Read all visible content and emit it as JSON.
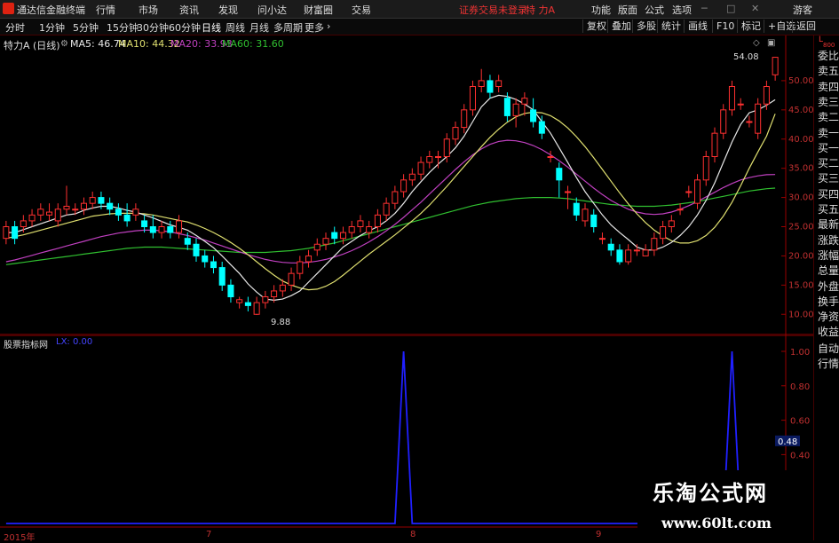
{
  "menubar": {
    "app_title": "通达信金融终端",
    "items": [
      "行情",
      "市场",
      "资讯",
      "发现",
      "问小达",
      "财富圈",
      "交易"
    ],
    "login_status": "证券交易未登录",
    "stock_name": "特 力A",
    "right_items": [
      "功能",
      "版面",
      "公式",
      "选项"
    ],
    "guest": "游客"
  },
  "periodbar": {
    "periods": [
      "分时",
      "1分钟",
      "5分钟",
      "15分钟",
      "30分钟",
      "60分钟",
      "日线",
      "周线",
      "月线",
      "多周期",
      "更多"
    ],
    "active_period": "日线",
    "tools": [
      "复权",
      "叠加",
      "多股",
      "统计",
      "画线",
      "F10",
      "标记",
      "+自选",
      "返回"
    ]
  },
  "main_chart": {
    "stock_label": "特力A",
    "period_label": "(日线)",
    "ma5": "MA5: 46.74",
    "ma10": "MA10: 44.32",
    "ma20": "MA20: 33.93",
    "ma60": "MA60: 31.60",
    "high_label": "54.08",
    "low_label": "9.88",
    "yaxis": [
      "50.00",
      "45.00",
      "40.00",
      "35.00",
      "30.00",
      "25.00",
      "20.00",
      "15.00",
      "10.00"
    ],
    "colors": {
      "up": "#ff3030",
      "down": "#00ffff",
      "ma5": "#e8e8e8",
      "ma10": "#e0e070",
      "ma20": "#c040c0",
      "ma60": "#30c030"
    }
  },
  "sub_chart": {
    "title": "股票指标网",
    "value_label": "LX: 0.00",
    "yaxis": [
      "1.00",
      "0.80",
      "0.60",
      "0.48",
      "0.40"
    ],
    "current_value": "0.48",
    "color": "#2020ff"
  },
  "xaxis": [
    "2015年",
    "7",
    "8",
    "9"
  ],
  "right_panel": {
    "corner_top": "L",
    "corner_bottom": "800",
    "items": [
      "委比",
      "卖五",
      "卖四",
      "卖三",
      "卖二",
      "卖一",
      "买一",
      "买二",
      "买三",
      "买四",
      "买五",
      "最新",
      "涨跌",
      "涨幅",
      "总量",
      "外盘",
      "换手",
      "净资",
      "收益"
    ],
    "bottom_items": [
      "自动",
      "行情"
    ]
  },
  "watermark": {
    "line1": "乐淘公式网",
    "line2": "www.60lt.com"
  },
  "chart_data": {
    "type": "candlestick",
    "title": "特力A (日线)",
    "ylim": [
      7,
      55
    ],
    "candles": [
      {
        "o": 23,
        "c": 25,
        "h": 26,
        "l": 22
      },
      {
        "o": 25,
        "c": 23,
        "h": 26,
        "l": 22
      },
      {
        "o": 25,
        "c": 26,
        "h": 27,
        "l": 24
      },
      {
        "o": 26,
        "c": 27,
        "h": 28,
        "l": 25
      },
      {
        "o": 27,
        "c": 28,
        "h": 29,
        "l": 26
      },
      {
        "o": 27,
        "c": 27.5,
        "h": 29,
        "l": 26
      },
      {
        "o": 26,
        "c": 28,
        "h": 29,
        "l": 25
      },
      {
        "o": 28,
        "c": 28.5,
        "h": 32,
        "l": 27
      },
      {
        "o": 28,
        "c": 28,
        "h": 29,
        "l": 27
      },
      {
        "o": 28,
        "c": 29,
        "h": 30,
        "l": 27
      },
      {
        "o": 29,
        "c": 30,
        "h": 31,
        "l": 28
      },
      {
        "o": 30,
        "c": 29,
        "h": 31,
        "l": 28
      },
      {
        "o": 29,
        "c": 28,
        "h": 30,
        "l": 27
      },
      {
        "o": 28,
        "c": 27,
        "h": 29,
        "l": 26
      },
      {
        "o": 27,
        "c": 26,
        "h": 29,
        "l": 25
      },
      {
        "o": 27,
        "c": 28,
        "h": 29,
        "l": 26
      },
      {
        "o": 26,
        "c": 25,
        "h": 27,
        "l": 24
      },
      {
        "o": 25,
        "c": 24,
        "h": 27,
        "l": 23
      },
      {
        "o": 24,
        "c": 25,
        "h": 26,
        "l": 23
      },
      {
        "o": 25,
        "c": 24,
        "h": 26,
        "l": 23
      },
      {
        "o": 24,
        "c": 26,
        "h": 27,
        "l": 23
      },
      {
        "o": 23,
        "c": 22,
        "h": 24,
        "l": 21
      },
      {
        "o": 22,
        "c": 20,
        "h": 23,
        "l": 19
      },
      {
        "o": 20,
        "c": 19,
        "h": 21,
        "l": 18
      },
      {
        "o": 19,
        "c": 18,
        "h": 20,
        "l": 17
      },
      {
        "o": 18,
        "c": 15,
        "h": 19,
        "l": 14
      },
      {
        "o": 15,
        "c": 13,
        "h": 16,
        "l": 12
      },
      {
        "o": 12,
        "c": 12.5,
        "h": 13,
        "l": 11
      },
      {
        "o": 12,
        "c": 11.5,
        "h": 13,
        "l": 10.5
      },
      {
        "o": 10,
        "c": 12,
        "h": 13,
        "l": 9.88
      },
      {
        "o": 12,
        "c": 13,
        "h": 14,
        "l": 11
      },
      {
        "o": 13,
        "c": 14,
        "h": 15,
        "l": 12
      },
      {
        "o": 14,
        "c": 15,
        "h": 16,
        "l": 13
      },
      {
        "o": 15,
        "c": 17,
        "h": 18,
        "l": 14
      },
      {
        "o": 17,
        "c": 19,
        "h": 20,
        "l": 16
      },
      {
        "o": 19,
        "c": 20,
        "h": 21,
        "l": 18
      },
      {
        "o": 21,
        "c": 22,
        "h": 23,
        "l": 20
      },
      {
        "o": 22,
        "c": 23,
        "h": 24,
        "l": 21
      },
      {
        "o": 24,
        "c": 23,
        "h": 25,
        "l": 22
      },
      {
        "o": 23,
        "c": 24,
        "h": 25,
        "l": 22
      },
      {
        "o": 24,
        "c": 25,
        "h": 26,
        "l": 23
      },
      {
        "o": 25,
        "c": 26,
        "h": 27,
        "l": 24
      },
      {
        "o": 24,
        "c": 25,
        "h": 26,
        "l": 23
      },
      {
        "o": 25,
        "c": 27,
        "h": 28,
        "l": 24
      },
      {
        "o": 27,
        "c": 29,
        "h": 30,
        "l": 26
      },
      {
        "o": 29,
        "c": 31,
        "h": 32,
        "l": 28
      },
      {
        "o": 31,
        "c": 33,
        "h": 34,
        "l": 30
      },
      {
        "o": 33,
        "c": 34,
        "h": 35,
        "l": 32
      },
      {
        "o": 34,
        "c": 36,
        "h": 37,
        "l": 33
      },
      {
        "o": 36,
        "c": 37,
        "h": 38,
        "l": 35
      },
      {
        "o": 37,
        "c": 37,
        "h": 38,
        "l": 35
      },
      {
        "o": 37,
        "c": 40,
        "h": 41,
        "l": 36
      },
      {
        "o": 40,
        "c": 42,
        "h": 43,
        "l": 39
      },
      {
        "o": 42,
        "c": 45,
        "h": 46,
        "l": 41
      },
      {
        "o": 45,
        "c": 49,
        "h": 50,
        "l": 44
      },
      {
        "o": 49,
        "c": 50,
        "h": 52,
        "l": 48
      },
      {
        "o": 50,
        "c": 48,
        "h": 51,
        "l": 47
      },
      {
        "o": 49,
        "c": 50,
        "h": 51,
        "l": 48
      },
      {
        "o": 47,
        "c": 44,
        "h": 48,
        "l": 43
      },
      {
        "o": 44,
        "c": 46,
        "h": 47,
        "l": 42
      },
      {
        "o": 46,
        "c": 47,
        "h": 48,
        "l": 44
      },
      {
        "o": 45,
        "c": 43,
        "h": 47,
        "l": 42
      },
      {
        "o": 43,
        "c": 41,
        "h": 44,
        "l": 40
      },
      {
        "o": 37,
        "c": 37,
        "h": 38,
        "l": 36
      },
      {
        "o": 35,
        "c": 33,
        "h": 36,
        "l": 30
      },
      {
        "o": 31,
        "c": 31,
        "h": 32,
        "l": 28
      },
      {
        "o": 29,
        "c": 27,
        "h": 30,
        "l": 26
      },
      {
        "o": 26,
        "c": 28,
        "h": 29,
        "l": 25
      },
      {
        "o": 27,
        "c": 25,
        "h": 28,
        "l": 24
      },
      {
        "o": 23,
        "c": 23,
        "h": 24,
        "l": 22
      },
      {
        "o": 22,
        "c": 21,
        "h": 23,
        "l": 20
      },
      {
        "o": 21,
        "c": 19,
        "h": 22,
        "l": 18.5
      },
      {
        "o": 19,
        "c": 21,
        "h": 22,
        "l": 18.5
      },
      {
        "o": 21,
        "c": 21,
        "h": 22,
        "l": 20
      },
      {
        "o": 20,
        "c": 21,
        "h": 22,
        "l": 20
      },
      {
        "o": 21,
        "c": 23,
        "h": 24,
        "l": 20
      },
      {
        "o": 23,
        "c": 25,
        "h": 26,
        "l": 22
      },
      {
        "o": 25,
        "c": 26,
        "h": 27,
        "l": 24
      },
      {
        "o": 28,
        "c": 28,
        "h": 29,
        "l": 27
      },
      {
        "o": 31,
        "c": 31,
        "h": 32,
        "l": 30
      },
      {
        "o": 29,
        "c": 33,
        "h": 34,
        "l": 28
      },
      {
        "o": 33,
        "c": 37,
        "h": 38,
        "l": 32
      },
      {
        "o": 37,
        "c": 41,
        "h": 42,
        "l": 36
      },
      {
        "o": 41,
        "c": 45,
        "h": 46,
        "l": 40
      },
      {
        "o": 45,
        "c": 49,
        "h": 50,
        "l": 44
      },
      {
        "o": 46,
        "c": 46,
        "h": 47,
        "l": 45
      },
      {
        "o": 43,
        "c": 43,
        "h": 44,
        "l": 42
      },
      {
        "o": 41,
        "c": 46,
        "h": 47,
        "l": 40
      },
      {
        "o": 46,
        "c": 49,
        "h": 50,
        "l": 45
      },
      {
        "o": 51,
        "c": 54,
        "h": 54.08,
        "l": 50
      }
    ],
    "ma5": [
      24,
      24,
      24.5,
      25,
      25.5,
      26,
      26.5,
      27,
      27.2,
      27.8,
      28.2,
      28.5,
      28.5,
      28.2,
      27.8,
      27.5,
      27,
      26.5,
      25.9,
      25.3,
      24.9,
      24.4,
      23.5,
      22.5,
      21.4,
      20,
      18.5,
      17,
      15.2,
      13.8,
      12.6,
      12.4,
      12.6,
      13.2,
      14,
      15.5,
      17,
      18.5,
      20,
      21.5,
      22.5,
      23.5,
      24.3,
      25,
      26,
      27.3,
      29,
      31,
      32.7,
      34.3,
      35.7,
      37,
      38.5,
      40.5,
      43,
      45.5,
      47,
      47.5,
      47.3,
      46.8,
      46,
      45,
      43,
      41,
      38.5,
      36,
      33.4,
      31,
      29,
      27,
      25.3,
      24,
      22.8,
      21.5,
      21,
      21,
      21.5,
      22.3,
      23.5,
      25,
      27,
      29.5,
      32.5,
      36,
      39.5,
      42.5,
      44.5,
      45,
      45.8,
      46.74
    ],
    "ma10": [
      23,
      23.3,
      23.6,
      24,
      24.4,
      24.8,
      25.2,
      25.6,
      26,
      26.4,
      26.8,
      27,
      27.2,
      27.3,
      27.3,
      27.3,
      27.2,
      27,
      26.7,
      26.4,
      26.1,
      25.8,
      25.3,
      24.7,
      24,
      23.2,
      22.3,
      21.3,
      20.2,
      19,
      17.8,
      16.7,
      15.7,
      15,
      14.5,
      14.2,
      14.3,
      14.8,
      15.6,
      16.7,
      17.9,
      19.1,
      20.3,
      21.4,
      22.5,
      23.6,
      24.8,
      26,
      27.3,
      28.7,
      30.3,
      31.9,
      33.6,
      35.3,
      37,
      38.7,
      40.3,
      41.7,
      42.9,
      43.8,
      44.4,
      44.6,
      44.5,
      44,
      43.1,
      41.9,
      40.4,
      38.7,
      36.8,
      34.8,
      32.8,
      30.8,
      28.9,
      27.2,
      25.7,
      24.4,
      23.4,
      22.6,
      22.2,
      22.2,
      22.6,
      23.5,
      24.9,
      26.8,
      29.2,
      32,
      35,
      37.8,
      40.5,
      44.32
    ],
    "ma20": [
      19,
      19.3,
      19.7,
      20.1,
      20.5,
      20.9,
      21.3,
      21.7,
      22.1,
      22.5,
      22.9,
      23.3,
      23.6,
      23.9,
      24.1,
      24.3,
      24.4,
      24.4,
      24.3,
      24.1,
      23.8,
      23.5,
      23.1,
      22.7,
      22.2,
      21.7,
      21.2,
      20.7,
      20.2,
      19.8,
      19.4,
      19.1,
      18.9,
      18.8,
      18.8,
      18.9,
      19.1,
      19.4,
      19.8,
      20.3,
      20.9,
      21.6,
      22.4,
      23.3,
      24.3,
      25.4,
      26.6,
      27.9,
      29.2,
      30.6,
      32,
      33.4,
      34.8,
      36.1,
      37.3,
      38.3,
      39.1,
      39.6,
      39.8,
      39.7,
      39.4,
      38.9,
      38.2,
      37.3,
      36.3,
      35.2,
      34,
      32.8,
      31.6,
      30.5,
      29.5,
      28.7,
      28,
      27.5,
      27.2,
      27.1,
      27.2,
      27.5,
      28,
      28.6,
      29.3,
      30.1,
      30.9,
      31.7,
      32.4,
      33,
      33.4,
      33.7,
      33.9,
      33.93
    ],
    "ma60": [
      18.5,
      18.7,
      18.9,
      19.1,
      19.3,
      19.5,
      19.7,
      19.9,
      20.1,
      20.3,
      20.5,
      20.7,
      20.9,
      21.1,
      21.3,
      21.4,
      21.5,
      21.5,
      21.5,
      21.4,
      21.3,
      21.2,
      21.1,
      21,
      20.9,
      20.8,
      20.7,
      20.6,
      20.6,
      20.6,
      20.6,
      20.7,
      20.8,
      20.9,
      21.1,
      21.3,
      21.6,
      21.9,
      22.2,
      22.6,
      23,
      23.4,
      23.8,
      24.2,
      24.6,
      25,
      25.4,
      25.8,
      26.2,
      26.6,
      27,
      27.4,
      27.8,
      28.2,
      28.6,
      28.9,
      29.2,
      29.4,
      29.6,
      29.8,
      29.9,
      30,
      30,
      30,
      29.9,
      29.8,
      29.6,
      29.4,
      29.2,
      29,
      28.8,
      28.7,
      28.6,
      28.5,
      28.5,
      28.5,
      28.6,
      28.7,
      28.9,
      29.1,
      29.3,
      29.6,
      29.9,
      30.2,
      30.5,
      30.8,
      31.1,
      31.3,
      31.5,
      31.6
    ],
    "sub_series": {
      "name": "LX",
      "spike_indices": [
        46,
        84
      ],
      "spike_value": 1.0,
      "current": 0.48
    }
  }
}
